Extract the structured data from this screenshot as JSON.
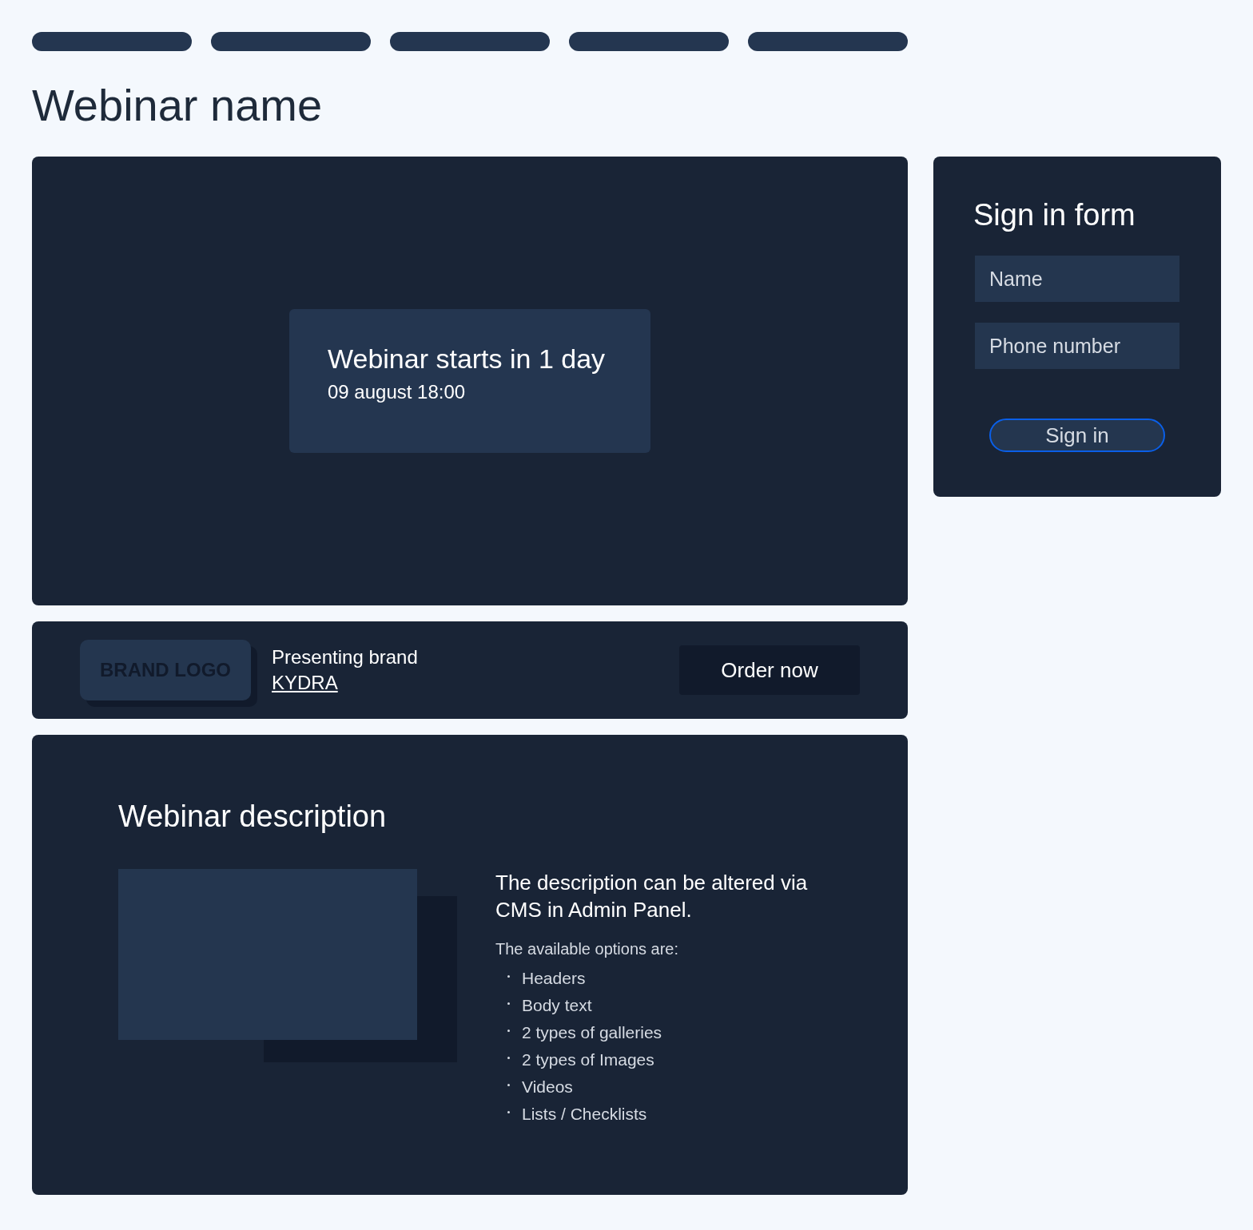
{
  "nav_items": [
    {
      "kind": "placeholder"
    },
    {
      "kind": "placeholder"
    },
    {
      "kind": "placeholder"
    },
    {
      "kind": "placeholder"
    },
    {
      "kind": "placeholder"
    }
  ],
  "page_title": "Webinar name",
  "player": {
    "countdown_title": "Webinar starts in 1 day",
    "countdown_date": "09 august 18:00"
  },
  "brand": {
    "logo": "BRAND LOGO",
    "label": "Presenting brand",
    "link": "KYDRA",
    "button": "Order now"
  },
  "description": {
    "title": "Webinar description",
    "image": {
      "kind": "placeholder"
    },
    "lead": "The description can be altered via CMS in Admin Panel.",
    "intro": "The available options are:",
    "items": [
      "Headers",
      "Body text",
      "2 types of galleries",
      "2 types of Images",
      "Videos",
      "Lists / Checklists"
    ]
  },
  "sign_in": {
    "title": "Sign in form",
    "fields": [
      {
        "placeholder": "Name"
      },
      {
        "placeholder": "Phone number"
      }
    ],
    "button": "Sign in"
  }
}
